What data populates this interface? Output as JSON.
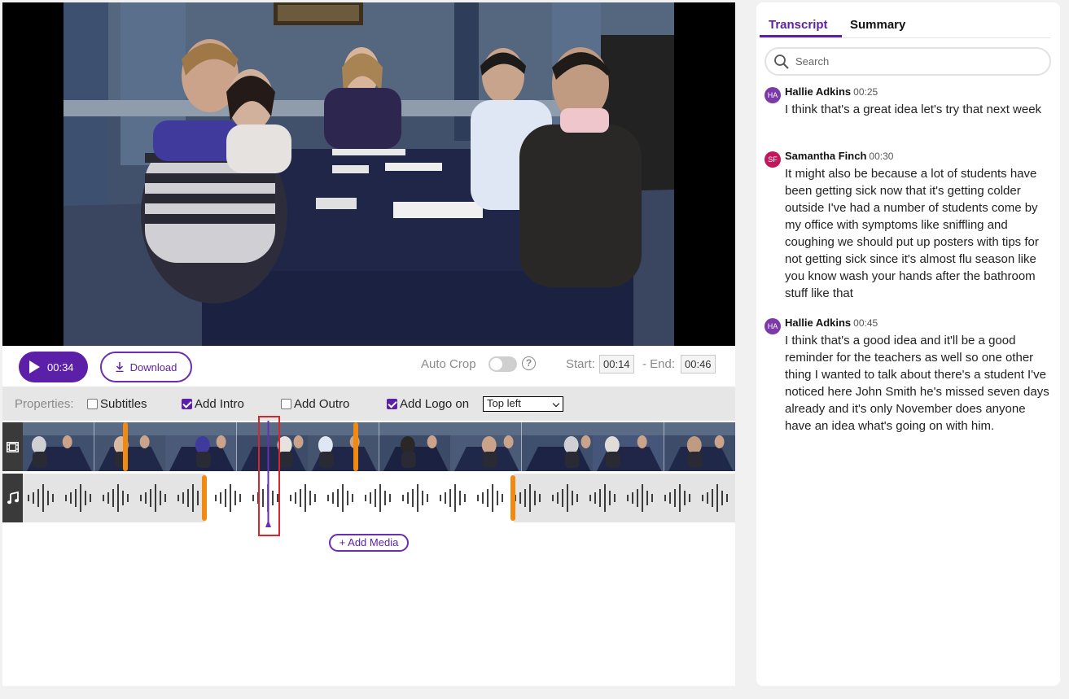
{
  "player": {
    "play_time": "00:34",
    "download_label": "Download",
    "auto_crop_label": "Auto Crop",
    "help_glyph": "?",
    "start_label": "Start:",
    "start_value": "00:14",
    "end_label": "- End:",
    "end_value": "00:46"
  },
  "properties": {
    "label": "Properties:",
    "subtitles": "Subtitles",
    "add_intro": "Add Intro",
    "add_outro": "Add Outro",
    "add_logo": "Add Logo on",
    "logo_position": "Top left"
  },
  "timeline": {
    "add_media": "+ Add Media"
  },
  "sidebar": {
    "tabs": [
      "Transcript",
      "Summary"
    ],
    "search_placeholder": "Search",
    "entries": [
      {
        "initials": "HA",
        "speaker": "Hallie Adkins",
        "time": "00:25",
        "text": "I think that's a great idea let's try that next week"
      },
      {
        "initials": "SF",
        "speaker": "Samantha Finch",
        "time": "00:30",
        "text": "It might also be because a lot of students have been getting sick now that it's getting colder outside I've had a number of students come by my office with symptoms like sniffling and coughing we should put up posters with tips for not getting sick since it's almost flu season like you know wash your hands after the bathroom stuff like that"
      },
      {
        "initials": "HA",
        "speaker": "Hallie Adkins",
        "time": "00:45",
        "text": "I think that's a good idea and it'll be a good reminder for the teachers as well so one other thing I wanted to talk about there's a student I've noticed here John Smith he's missed seven days already and it's only November does anyone have an idea what's going on with him."
      }
    ]
  },
  "colors": {
    "accent": "#5b1fa8",
    "marker": "#f28a12",
    "avatar_ha": "#7b3aa8",
    "avatar_sf": "#c2185b",
    "highlight": "#d9262c"
  }
}
